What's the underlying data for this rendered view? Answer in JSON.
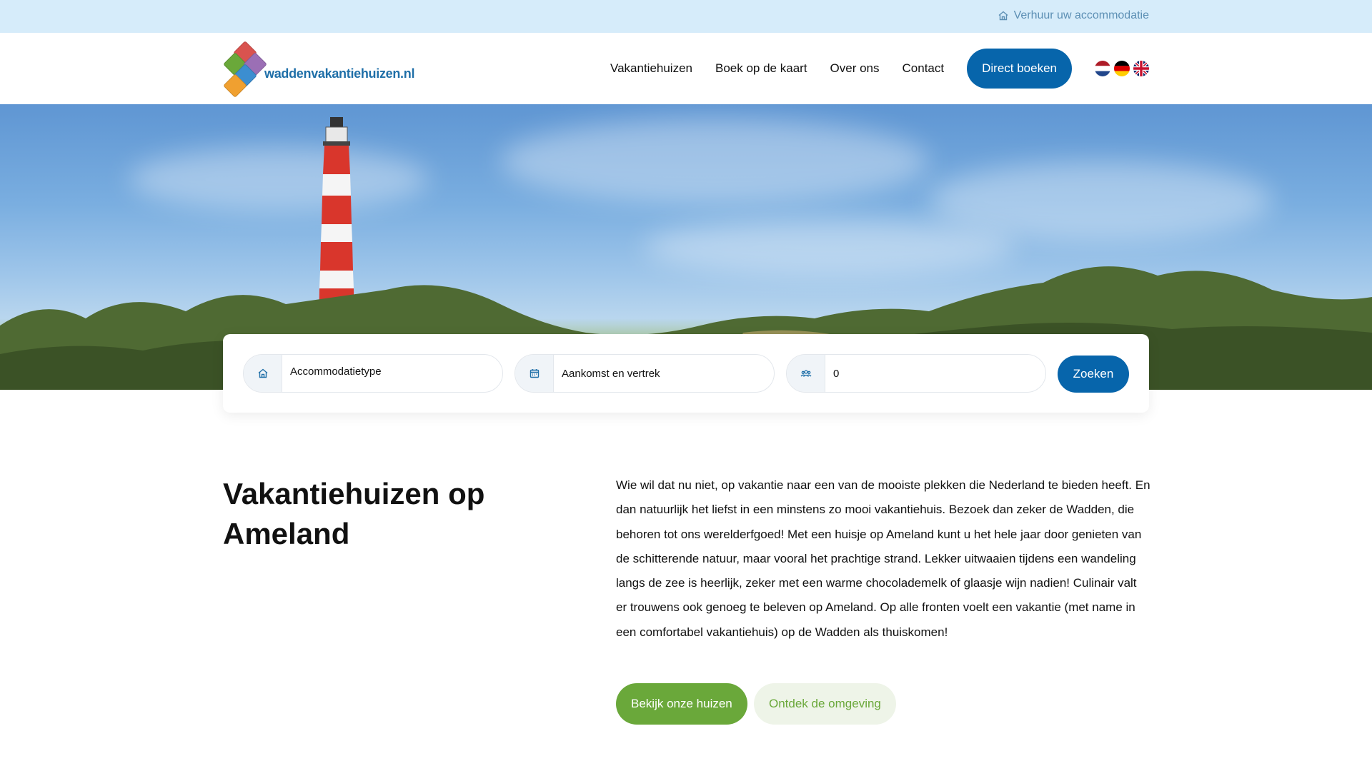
{
  "topbar": {
    "link_label": "Verhuur uw accommodatie",
    "icon": "home-icon"
  },
  "header": {
    "logo_text": "waddenvakantiehuizen.nl",
    "nav": [
      "Vakantiehuizen",
      "Boek op de kaart",
      "Over ons",
      "Contact"
    ],
    "cta_label": "Direct boeken",
    "languages": [
      "nl",
      "de",
      "en"
    ]
  },
  "search": {
    "type_placeholder": "Accommodatietype",
    "dates_placeholder": "Aankomst en vertrek",
    "guests_value": "0",
    "button_label": "Zoeken"
  },
  "intro": {
    "title": "Vakantiehuizen op Ameland",
    "text": "Wie wil dat nu niet, op vakantie naar een van de mooiste plekken die Nederland te bieden heeft. En dan natuurlijk het liefst in een minstens zo mooi vakantiehuis. Bezoek dan zeker de Wadden, die behoren tot ons werelderfgoed! Met een huisje op Ameland kunt u het hele jaar door genieten van de schitterende natuur, maar vooral het prachtige strand. Lekker uitwaaien tijdens een wandeling langs de zee is heerlijk, zeker met een warme chocolademelk of glaasje wijn nadien! Culinair valt er trouwens ook genoeg te beleven op Ameland. Op alle fronten voelt een vakantie (met name in een comfortabel vakantiehuis) op de Wadden als thuiskomen!",
    "primary_button": "Bekijk onze huizen",
    "secondary_button": "Ontdek de omgeving"
  },
  "colors": {
    "primary": "#0765ab",
    "green": "#6aa83a",
    "topbar": "#d6ecfa"
  }
}
